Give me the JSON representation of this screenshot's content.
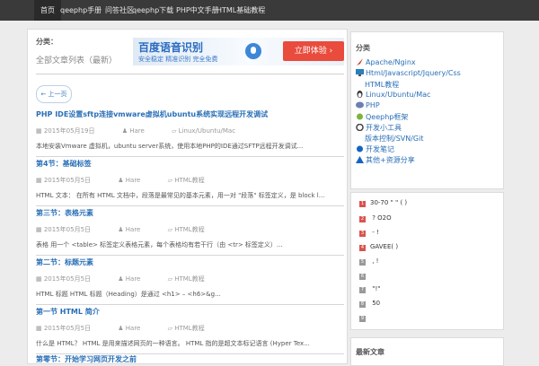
{
  "nav": [
    {
      "label": "首页"
    },
    {
      "label": "qeephp手册"
    },
    {
      "label": "问答社区"
    },
    {
      "label": "qeephp下载"
    },
    {
      "label": "PHP中文手册"
    },
    {
      "label": "HTML基础教程"
    }
  ],
  "main": {
    "category_label": "分类：",
    "category_sub": "全部文章列表（最新）",
    "banner": {
      "title": "百度语音识别",
      "subtitle": "安全稳定  精准识别  完全免费",
      "cta": "立即体验 ›"
    },
    "back_label": "← 上一页",
    "posts": [
      {
        "title": "PHP IDE设置sftp连接vmware虚拟机ubuntu系统实现远程开发调试",
        "date": "2015年05月19日",
        "author": "Hare",
        "category": "Linux/Ubuntu/Mac",
        "excerpt": "本地安装Vmware 虚拟机，ubuntu server系统，使用本地PHP的IDE通过SFTP远程开发调试..."
      },
      {
        "title": "第4节：基础标签",
        "date": "2015年05月5日",
        "author": "Hare",
        "category": "HTML教程",
        "excerpt": "HTML 文本： 在所有 HTML 文档中，段落是最常见的基本元素，用一对 \"段落\" 标签定义，是 block l..."
      },
      {
        "title": "第三节：表格元素",
        "date": "2015年05月5日",
        "author": "Hare",
        "category": "HTML教程",
        "excerpt": "表格 用一个 <table> 标签定义表格元素，每个表格均有若干行（由 <tr> 标签定义）..."
      },
      {
        "title": "第二节：标题元素",
        "date": "2015年05月5日",
        "author": "Hare",
        "category": "HTML教程",
        "excerpt": "HTML 标题 HTML 标题（Heading）是通过 <h1> – <h6>&g..."
      },
      {
        "title": "第一节 HTML 简介",
        "date": "2015年05月5日",
        "author": "Hare",
        "category": "HTML教程",
        "excerpt": "什么是 HTML？ HTML 是用来描述网页的一种语言。 HTML 指的是超文本标记语言 (Hyper Tex..."
      },
      {
        "title": "第零节：开始学习网页开发之前",
        "date": "",
        "author": "",
        "category": "",
        "excerpt": ""
      }
    ]
  },
  "sidebar": {
    "categories_title": "分类",
    "categories": [
      {
        "label": "Apache/Nginx",
        "icon": "feather-icon",
        "color": "#c0392b"
      },
      {
        "label": "Html/Javascript/Jquery/Css",
        "icon": "monitor-icon",
        "color": "#2980b9"
      },
      {
        "label": "HTML教程",
        "icon": "",
        "color": ""
      },
      {
        "label": "Linux/Ubuntu/Mac",
        "icon": "penguin-icon",
        "color": "#333333"
      },
      {
        "label": "PHP",
        "icon": "php-icon",
        "color": "#6c7eb7"
      },
      {
        "label": "Qeephp框架",
        "icon": "qeephp-icon",
        "color": "#7cb342"
      },
      {
        "label": "开发小工具",
        "icon": "tools-icon",
        "color": "#444444"
      },
      {
        "label": "版本控制/SVN/Git",
        "icon": "",
        "color": ""
      },
      {
        "label": "开发笔记",
        "icon": "notes-icon",
        "color": "#1565c0"
      },
      {
        "label": "其他+资源分享",
        "icon": "share-icon",
        "color": "#1565c0"
      }
    ],
    "hot": [
      {
        "rank": "1",
        "text": "30-70  \"  \"   ( )"
      },
      {
        "rank": "2",
        "text": "    ?    O2O"
      },
      {
        "rank": "3",
        "text": "    -      !"
      },
      {
        "rank": "4",
        "text": "GAVEE(    )"
      },
      {
        "rank": "5",
        "text": "      ,      !"
      },
      {
        "rank": "6",
        "text": ""
      },
      {
        "rank": "7",
        "text": "    \"!\""
      },
      {
        "rank": "8",
        "text": "      50"
      },
      {
        "rank": "9",
        "text": ""
      }
    ],
    "third_title": "最新文章"
  }
}
